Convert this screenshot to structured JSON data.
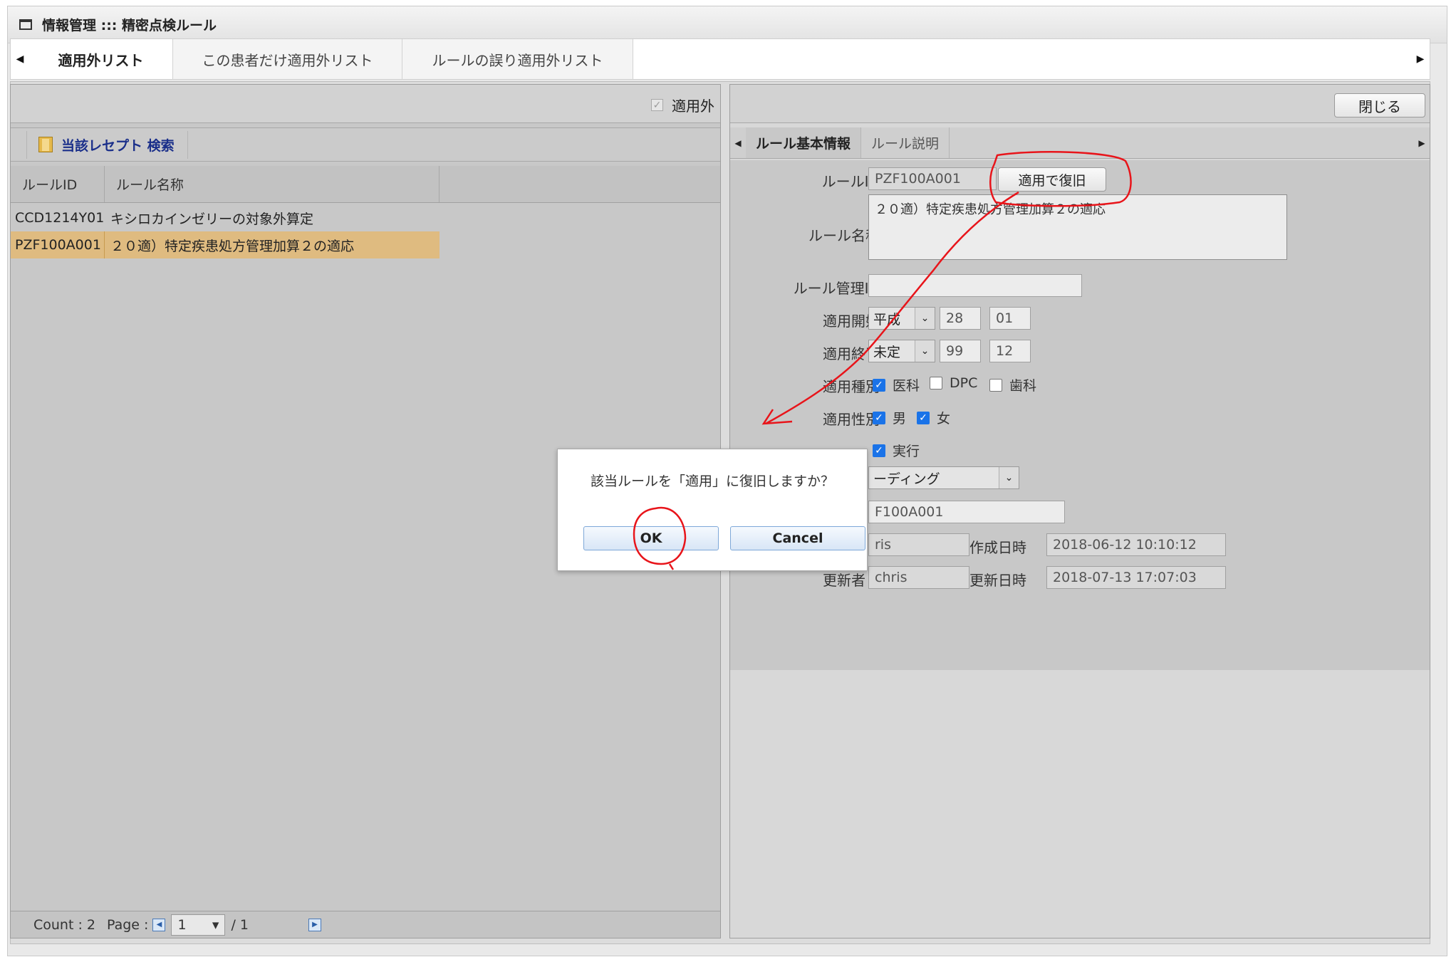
{
  "window": {
    "title": "情報管理 ::: 精密点検ルール"
  },
  "tabs": [
    {
      "label": "適用外リスト"
    },
    {
      "label": "この患者だけ適用外リスト"
    },
    {
      "label": "ルールの誤り適用外リスト"
    }
  ],
  "left_panel": {
    "filter_checkbox_label": "適用外",
    "search_button_label": "当該レセプト 検索",
    "columns": [
      "ルールID",
      "ルール名称"
    ],
    "rows": [
      {
        "id": "CCD1214Y01",
        "name": "キシロカインゼリーの対象外算定"
      },
      {
        "id": "PZF100A001",
        "name": "２０適）特定疾患処方管理加算２の適応"
      }
    ],
    "pager": {
      "count_text": "Count : 2",
      "page_label": "Page :",
      "page_value": "1",
      "total_text": "/ 1"
    }
  },
  "right_panel": {
    "close_button_label": "閉じる",
    "tabs": [
      "ルール基本情報",
      "ルール説明"
    ],
    "labels": {
      "rule_id": "ルールID",
      "rule_name": "ルール名称",
      "rule_mgmt_id": "ルール管理ID",
      "start": "適用開始",
      "end": "適用終了",
      "kind": "適用種別",
      "gender": "適用性別",
      "updater": "更新者",
      "created_at": "作成日時",
      "updated_at": "更新日時"
    },
    "values": {
      "rule_id": "PZF100A001",
      "rule_name": "２０適）特定疾患処方管理加算２の適応",
      "rule_mgmt_id": "",
      "start_era": "平成",
      "start_year": "28",
      "start_month": "01",
      "end_era": "未定",
      "end_year": "99",
      "end_month": "12",
      "exec_label": "実行",
      "mode_select": "ーディング",
      "code_partial": "F100A001",
      "creator_partial": "ris",
      "created_at": "2018-06-12 10:10:12",
      "updater": "chris",
      "updated_at": "2018-07-13 17:07:03"
    },
    "restore_button_label": "適用で復旧",
    "kinds": [
      {
        "label": "医科",
        "checked": true
      },
      {
        "label": "DPC",
        "checked": false
      },
      {
        "label": "歯科",
        "checked": false
      }
    ],
    "genders": [
      {
        "label": "男",
        "checked": true
      },
      {
        "label": "女",
        "checked": true
      }
    ]
  },
  "dialog": {
    "message": "該当ルールを「適用」に復旧しますか？",
    "ok_label": "OK",
    "cancel_label": "Cancel"
  },
  "colors": {
    "selected_row": "#dfbb80",
    "annotation": "#e8141a",
    "checkbox_on": "#1a73e8"
  }
}
